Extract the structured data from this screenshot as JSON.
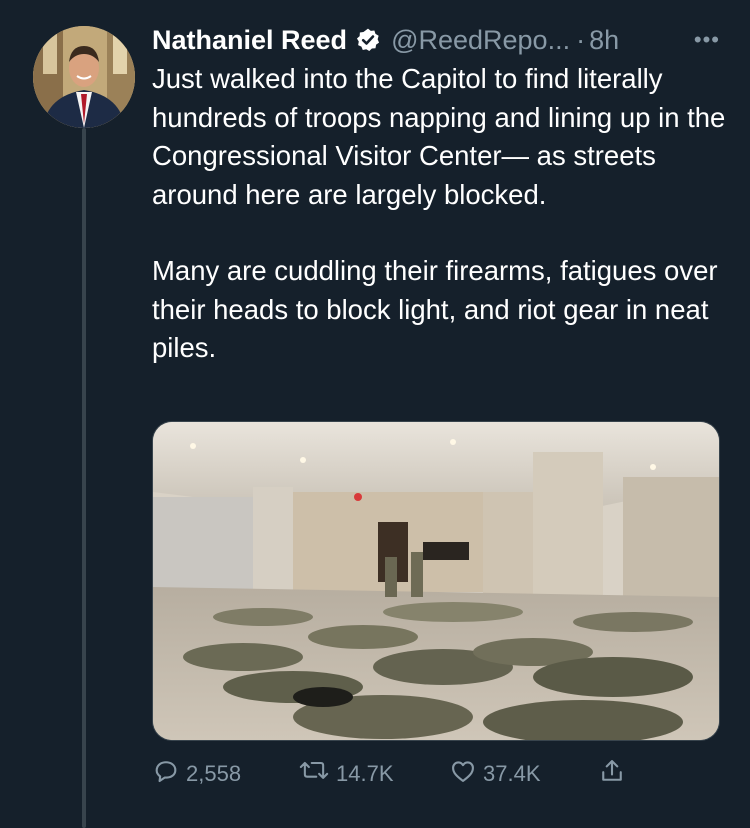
{
  "tweet": {
    "author_name": "Nathaniel Reed",
    "handle": "@ReedRepo...",
    "separator": "·",
    "time": "8h",
    "more_label": "•••",
    "paragraphs": [
      "Just walked into the Capitol to find literally hundreds of troops napping and lining up in the Congressional Visitor Center— as streets around here are largely blocked.",
      "Many are cuddling their firearms, fatigues over their heads to block light, and riot gear in neat piles."
    ]
  },
  "actions": {
    "reply_count": "2,558",
    "retweet_count": "14.7K",
    "like_count": "37.4K"
  },
  "icons": {
    "verified": "verified-badge-icon",
    "more": "more-dots-icon",
    "reply": "reply-bubble-icon",
    "retweet": "retweet-arrows-icon",
    "like": "heart-icon",
    "share": "share-upload-icon"
  },
  "colors": {
    "background": "#15202b",
    "text": "#ffffff",
    "muted": "#8899a6",
    "thread_line": "#38444d"
  }
}
